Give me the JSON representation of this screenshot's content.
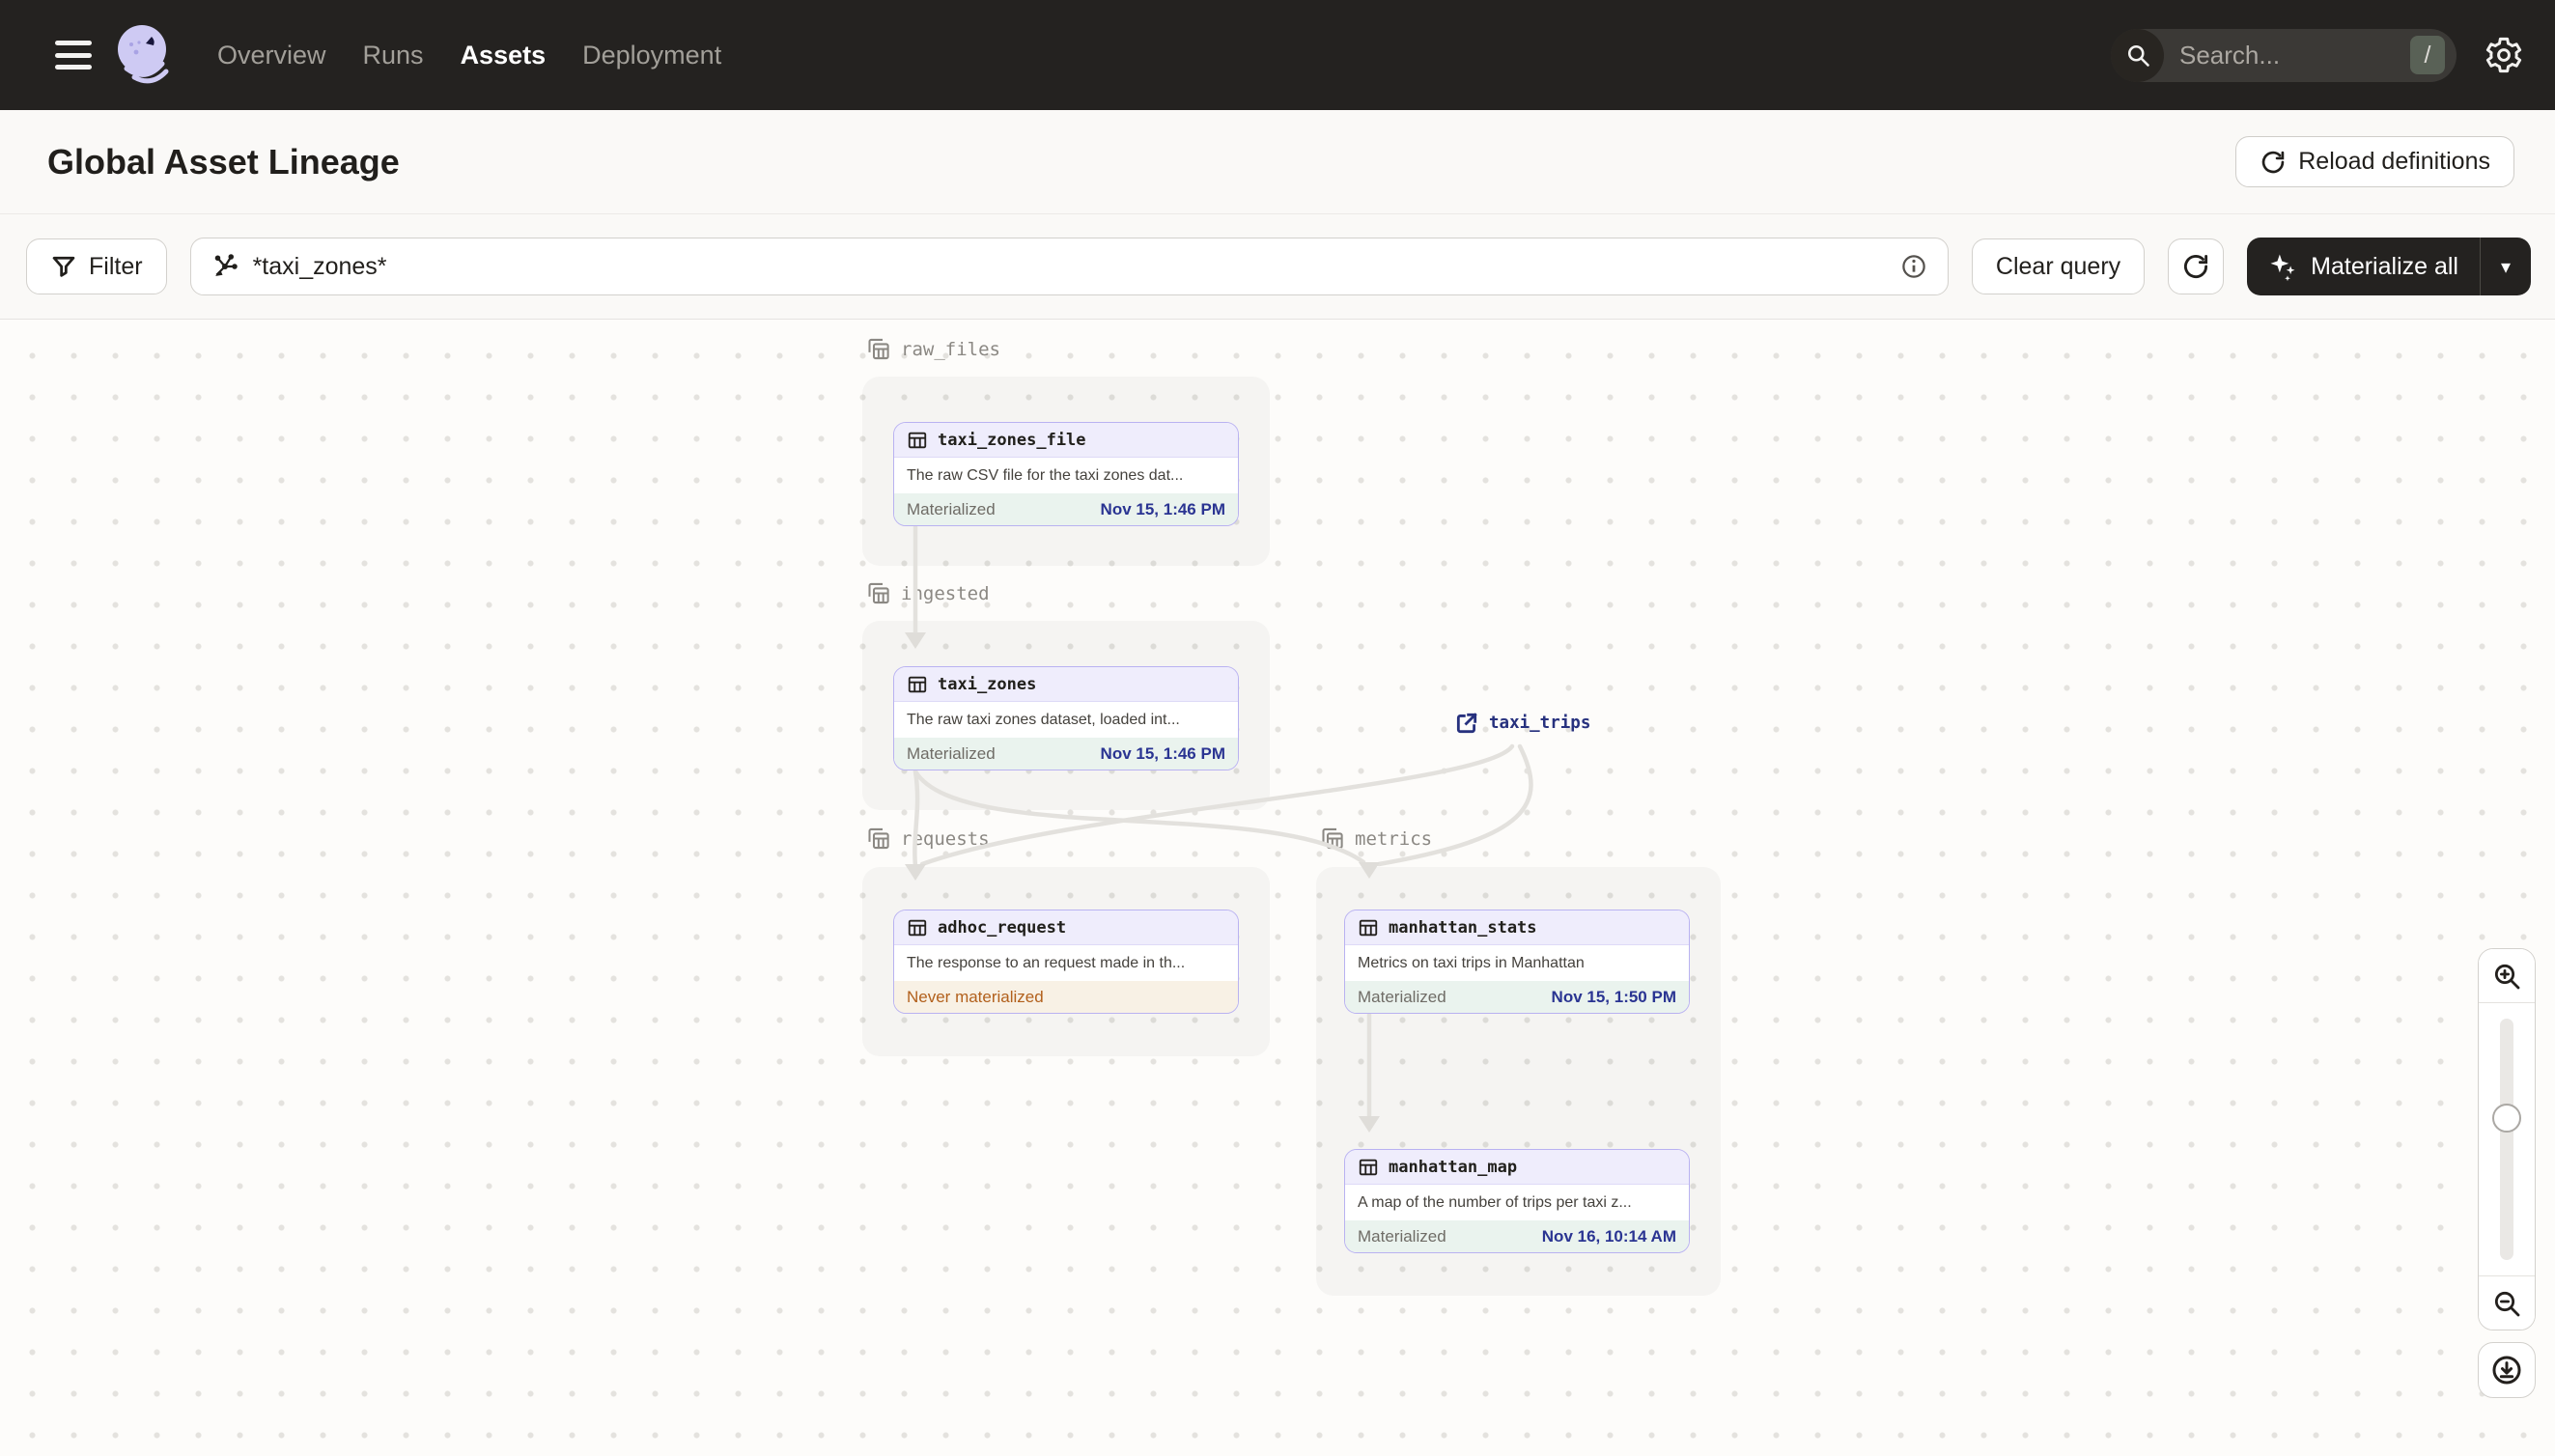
{
  "nav": {
    "items": [
      {
        "label": "Overview",
        "active": false
      },
      {
        "label": "Runs",
        "active": false
      },
      {
        "label": "Assets",
        "active": true
      },
      {
        "label": "Deployment",
        "active": false
      }
    ],
    "search": {
      "placeholder": "Search...",
      "shortcut": "/"
    }
  },
  "header": {
    "title": "Global Asset Lineage",
    "reload_button": "Reload definitions"
  },
  "toolbar": {
    "filter_button": "Filter",
    "query_value": "*taxi_zones*",
    "clear_button": "Clear query",
    "materialize_button": "Materialize all",
    "caret_down": "▾"
  },
  "graph": {
    "groups": [
      {
        "name": "raw_files"
      },
      {
        "name": "ingested"
      },
      {
        "name": "requests"
      },
      {
        "name": "metrics"
      }
    ],
    "nodes": [
      {
        "name": "taxi_zones_file",
        "group": "raw_files",
        "description": "The raw CSV file for the taxi zones dat...",
        "status": "Materialized",
        "timestamp": "Nov 15, 1:46 PM"
      },
      {
        "name": "taxi_zones",
        "group": "ingested",
        "description": "The raw taxi zones dataset, loaded int...",
        "status": "Materialized",
        "timestamp": "Nov 15, 1:46 PM"
      },
      {
        "name": "adhoc_request",
        "group": "requests",
        "description": "The response to an request made in th...",
        "status": "Never materialized",
        "timestamp": ""
      },
      {
        "name": "manhattan_stats",
        "group": "metrics",
        "description": "Metrics on taxi trips in Manhattan",
        "status": "Materialized",
        "timestamp": "Nov 15, 1:50 PM"
      },
      {
        "name": "manhattan_map",
        "group": "metrics",
        "description": "A map of the number of trips per taxi z...",
        "status": "Materialized",
        "timestamp": "Nov 16, 10:14 AM"
      }
    ],
    "external_assets": [
      {
        "name": "taxi_trips"
      }
    ]
  },
  "colors": {
    "nav_background": "#242220",
    "node_border_purple": "#B9B2F1",
    "node_header_purple": "#EFEDFC",
    "materialized_bg_green": "#EAF3EE",
    "timestamp_blue": "#2A3492",
    "never_materialized_orange": "#B2601C",
    "never_materialized_bg": "#F8F1E5",
    "edge_gray": "#E3E1DD",
    "external_asset_navy": "#27317E"
  }
}
